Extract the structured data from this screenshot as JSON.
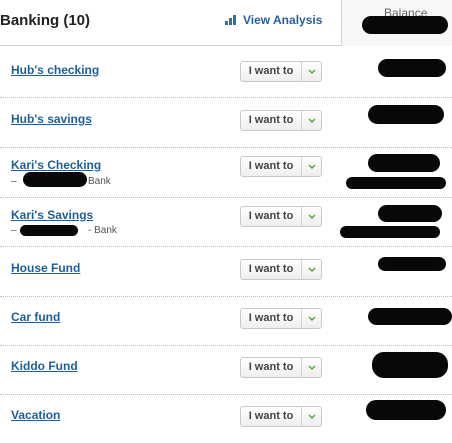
{
  "header": {
    "title": "Banking (10)",
    "view_analysis": "View Analysis",
    "balance_label": "Balance"
  },
  "dropdown_label": "I want to",
  "accounts": [
    {
      "name": "Hub's checking"
    },
    {
      "name": "Hub's savings"
    },
    {
      "name": "Kari's Checking",
      "sub_prefix": "–",
      "sub_suffix": "Bank"
    },
    {
      "name": "Kari's Savings",
      "sub_prefix": "–",
      "sub_suffix": "- Bank"
    },
    {
      "name": "House Fund"
    },
    {
      "name": "Car fund"
    },
    {
      "name": "Kiddo Fund"
    },
    {
      "name": "Vacation"
    }
  ],
  "colors": {
    "link": "#1f5f99",
    "chevron": "#5aa63c",
    "redaction": "#080808"
  }
}
